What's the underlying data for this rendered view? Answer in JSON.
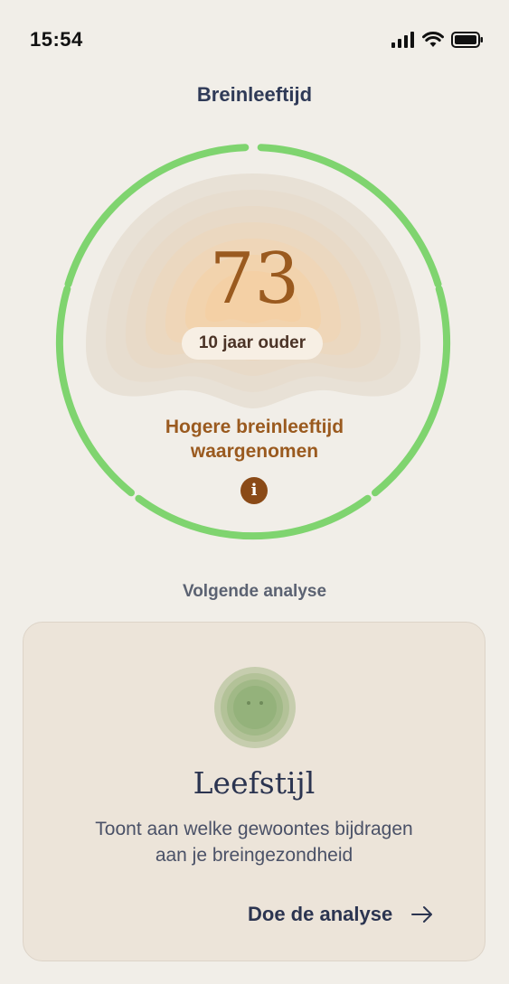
{
  "status_bar": {
    "time": "15:54",
    "signal_icon": "signal-icon",
    "wifi_icon": "wifi-icon",
    "battery_icon": "battery-icon"
  },
  "header": {
    "title": "Breinleeftijd"
  },
  "brain_age": {
    "score": "73",
    "difference_label": "10 jaar ouder",
    "verdict_line1": "Hogere breinleeftijd",
    "verdict_line2": "waargenomen",
    "info_icon": "info-icon",
    "ring_color": "#7fd46f",
    "accent_color": "#9a5a1f"
  },
  "next_analysis": {
    "section_label": "Volgende analyse",
    "card": {
      "icon": "face-icon",
      "title": "Leefstijl",
      "description_line1": "Toont aan welke gewoontes bijdragen",
      "description_line2": "aan je breingezondheid",
      "cta_label": "Doe de analyse",
      "cta_icon": "arrow-right-icon"
    }
  }
}
